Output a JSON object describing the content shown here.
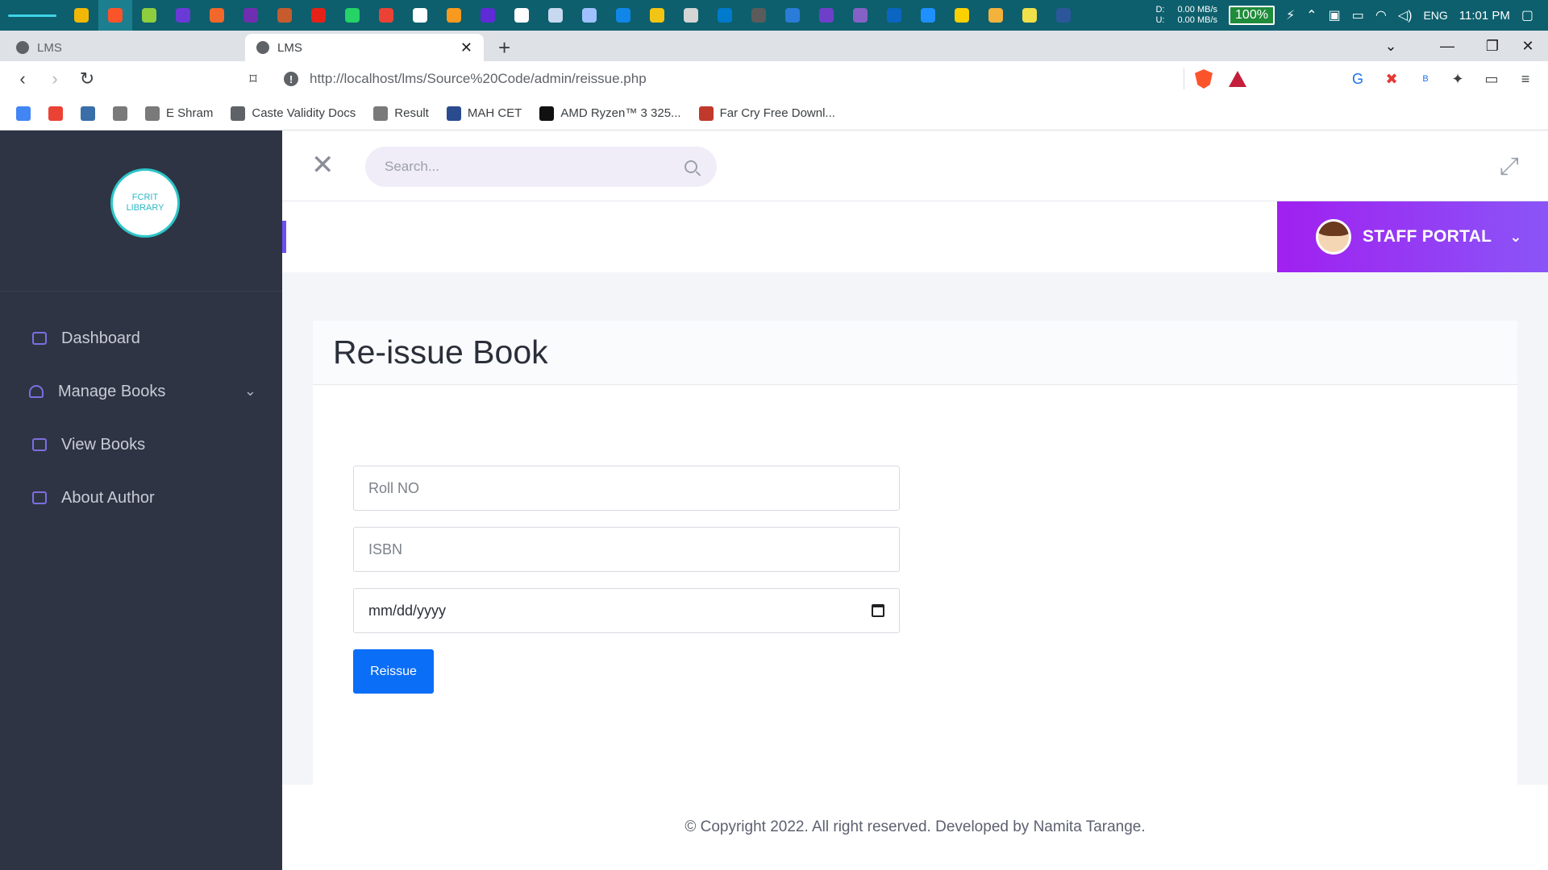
{
  "taskbar": {
    "net_labels": [
      "D:",
      "U:"
    ],
    "net_down": "0.00 MB/s",
    "net_up": "0.00 MB/s",
    "battery": "100%",
    "language": "ENG",
    "time": "11:01 PM",
    "app_colors": [
      "#f2b705",
      "#fb542b",
      "#8fce3e",
      "#6a3ad7",
      "#f2672a",
      "#6f2fb0",
      "#c65b2e",
      "#e62117",
      "#25d366",
      "#ea4335",
      "#ffffff",
      "#f79a1f",
      "#5e2bd6",
      "#ffffff",
      "#c7d8ef",
      "#9fc1ff",
      "#0f86e8",
      "#f2c515",
      "#d5d5d5",
      "#007acc",
      "#5b5b5b",
      "#2b7bd8",
      "#6e40c9",
      "#8561c5",
      "#0a66c2",
      "#1e90ff",
      "#fbd000",
      "#f3b23c",
      "#f0e14a",
      "#2b579a"
    ]
  },
  "browser": {
    "tabs": [
      {
        "title": "LMS"
      },
      {
        "title": "LMS"
      }
    ],
    "url": "http://localhost/lms/Source%20Code/admin/reissue.php",
    "bookmarks": [
      {
        "label": "",
        "icon": "google-icon",
        "color": "#4285f4"
      },
      {
        "label": "",
        "icon": "gmail-icon",
        "color": "#ea4335"
      },
      {
        "label": "",
        "icon": "tumblr-icon",
        "color": "#3a6ea8"
      },
      {
        "label": "",
        "icon": "emblem-icon",
        "color": "#7a7a7a"
      },
      {
        "label": "E Shram",
        "icon": "emblem-icon",
        "color": "#7a7a7a"
      },
      {
        "label": "Caste Validity Docs",
        "icon": "globe-icon",
        "color": "#5f6368"
      },
      {
        "label": "Result",
        "icon": "seal-icon",
        "color": "#7a7a7a"
      },
      {
        "label": "MAH CET",
        "icon": "circle-logo-icon",
        "color": "#2a4b8d"
      },
      {
        "label": "AMD Ryzen™ 3 325...",
        "icon": "amd-icon",
        "color": "#111111"
      },
      {
        "label": "Far Cry Free Downl...",
        "icon": "gamepad-icon",
        "color": "#c0392b"
      }
    ]
  },
  "app": {
    "logo": {
      "line1": "FCRIT",
      "line2": "LIBRARY"
    },
    "menu": [
      {
        "label": "Dashboard"
      },
      {
        "label": "Manage Books"
      },
      {
        "label": "View Books"
      },
      {
        "label": "About Author"
      }
    ],
    "search_placeholder": "Search...",
    "portal_label": "STAFF PORTAL",
    "page_title": "Re-issue Book",
    "form": {
      "roll_placeholder": "Roll NO",
      "isbn_placeholder": "ISBN",
      "date_placeholder": "mm/dd/yyyy",
      "submit_label": "Reissue"
    },
    "footer": "© Copyright 2022. All right reserved. Developed by Namita Tarange."
  }
}
